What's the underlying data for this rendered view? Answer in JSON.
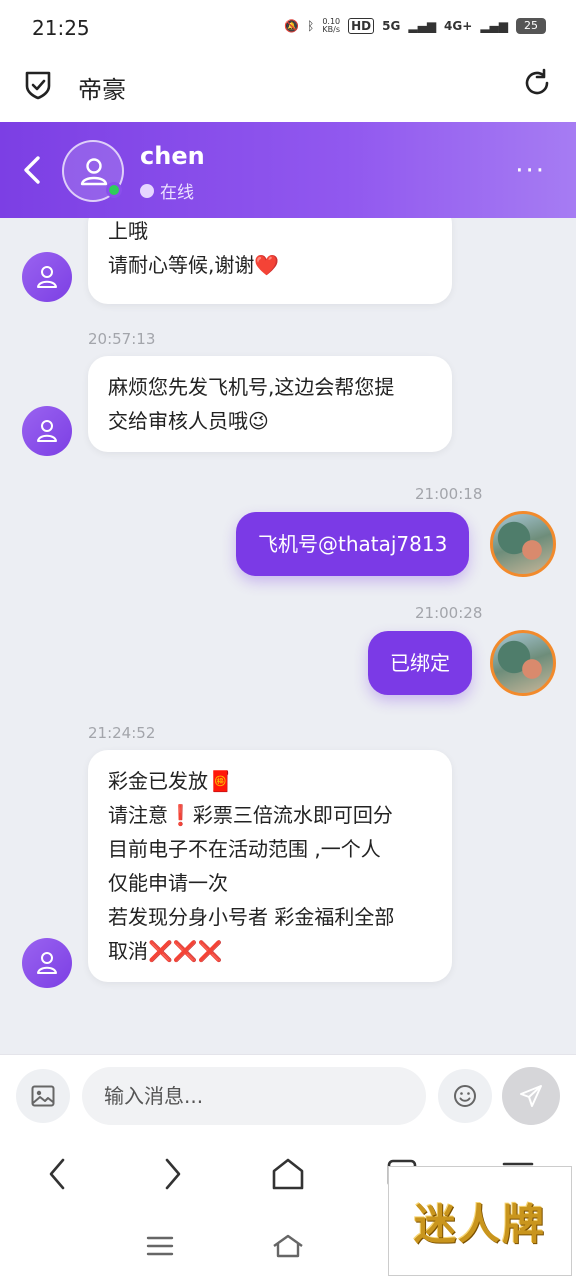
{
  "status_bar": {
    "time": "21:25",
    "net_speed_value": "0.10",
    "net_speed_unit": "KB/s",
    "hd_label": "HD",
    "signal_1": "5G",
    "signal_2": "4G+",
    "battery": "25"
  },
  "browser": {
    "title": "帝豪"
  },
  "chat_header": {
    "name": "chen",
    "status": "在线"
  },
  "messages": [
    {
      "side": "in",
      "text_lines": [
        "上哦",
        "请耐心等候,谢谢❤️"
      ]
    },
    {
      "side": "in",
      "timestamp": "20:57:13",
      "text_lines": [
        "麻烦您先发飞机号,这边会帮您提",
        "交给审核人员哦😉"
      ]
    },
    {
      "side": "out",
      "timestamp": "21:00:18",
      "text": "飞机号@thataj7813"
    },
    {
      "side": "out",
      "timestamp": "21:00:28",
      "text": "已绑定"
    },
    {
      "side": "in",
      "timestamp": "21:24:52",
      "text_lines": [
        "彩金已发放🧧",
        "请注意❗彩票三倍流水即可回分",
        "目前电子不在活动范围 ,一个人",
        "仅能申请一次",
        "若发现分身小号者 彩金福利全部",
        "取消❌❌❌"
      ]
    }
  ],
  "input": {
    "placeholder": "输入消息..."
  },
  "watermark": "迷人牌",
  "colors": {
    "accent": "#7b3ae6",
    "online": "#2fcc5b",
    "avatar_ring": "#f28a2c"
  }
}
